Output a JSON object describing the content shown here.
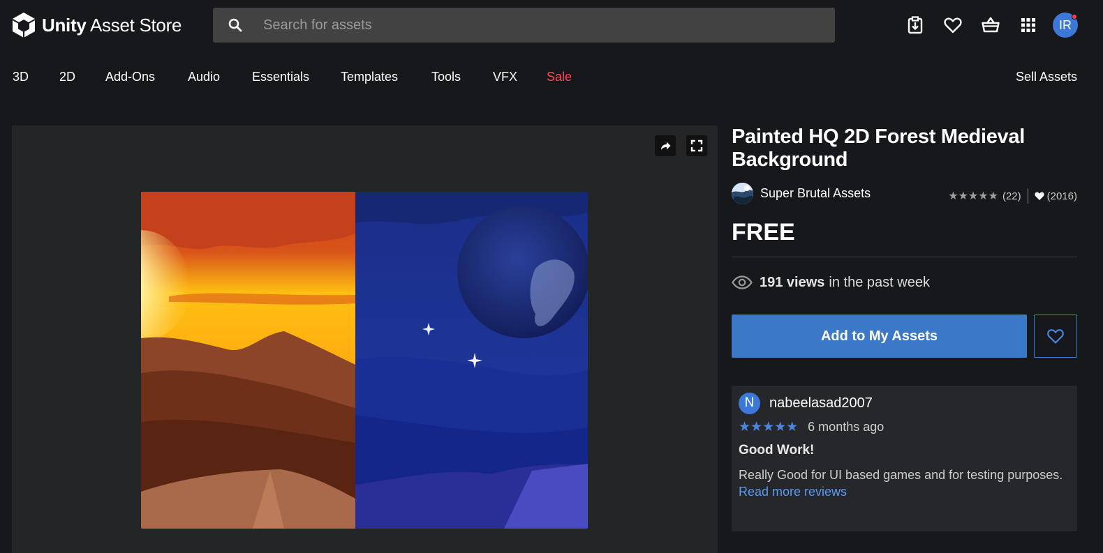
{
  "header": {
    "logo_bold": "Unity",
    "logo_light": "Asset Store",
    "search_placeholder": "Search for assets",
    "avatar_initials": "IR"
  },
  "nav": {
    "items": [
      "3D",
      "2D",
      "Add-Ons",
      "Audio",
      "Essentials",
      "Templates",
      "Tools",
      "VFX",
      "Sale"
    ],
    "sell": "Sell Assets"
  },
  "product": {
    "title": "Painted HQ 2D Forest Medieval Background",
    "publisher": "Super Brutal Assets",
    "rating_stars": 5,
    "rating_count": "(22)",
    "favorites_count": "(2016)",
    "price": "FREE",
    "views_count": "191 views",
    "views_suffix": "in the past week",
    "add_button": "Add to My Assets"
  },
  "review": {
    "avatar_initial": "N",
    "user": "nabeelasad2007",
    "stars": 5,
    "date": "6 months ago",
    "title": "Good Work!",
    "body": "Really Good for UI based games and for testing purposes.",
    "link": "Read more reviews"
  },
  "colors": {
    "background": "#17181b",
    "accent": "#3c78c8",
    "sale": "#ff4d57",
    "link": "#5a9cf0"
  }
}
